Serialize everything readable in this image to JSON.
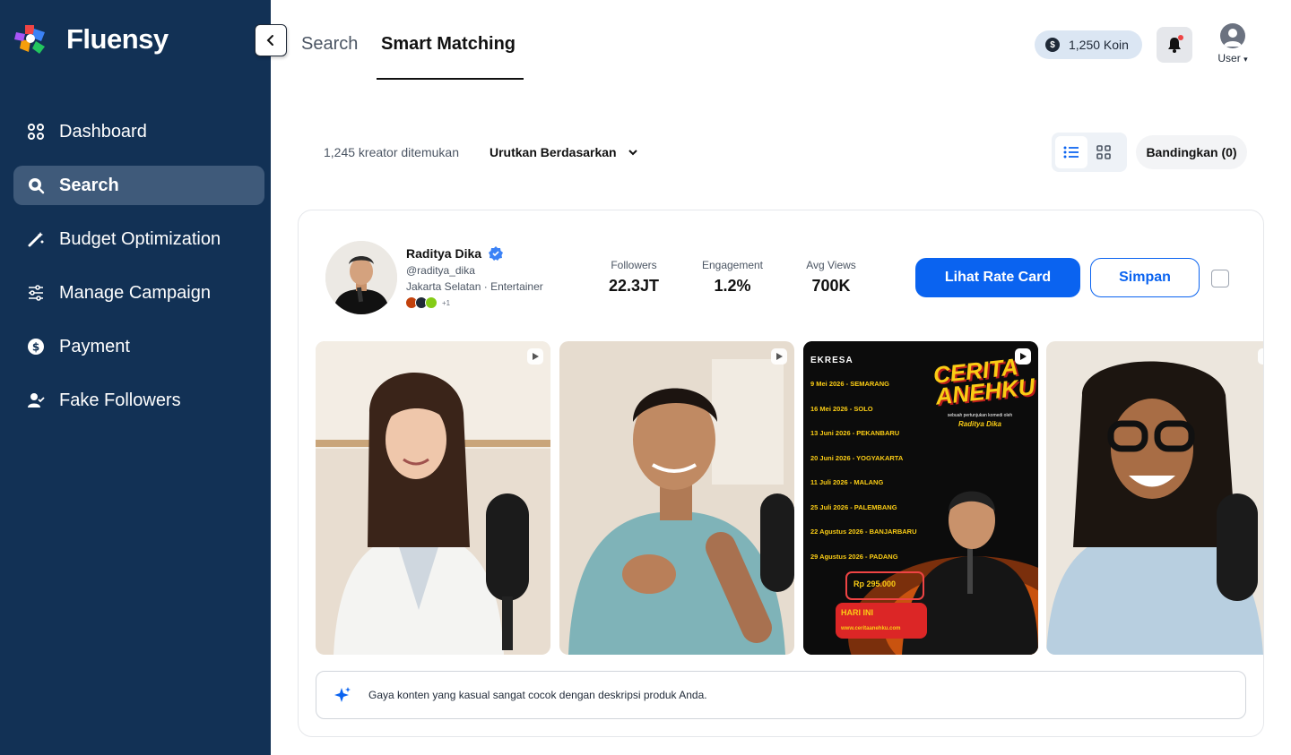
{
  "app": {
    "name": "Fluensy"
  },
  "sidebar": {
    "items": [
      {
        "label": "Dashboard",
        "icon": "dashboard-icon"
      },
      {
        "label": "Search",
        "icon": "search-icon",
        "active": true
      },
      {
        "label": "Budget Optimization",
        "icon": "magic-wand-icon"
      },
      {
        "label": "Manage Campaign",
        "icon": "sliders-icon"
      },
      {
        "label": "Payment",
        "icon": "dollar-icon"
      },
      {
        "label": "Fake Followers",
        "icon": "user-check-icon"
      }
    ]
  },
  "header": {
    "tabs": [
      {
        "label": "Search",
        "active": false
      },
      {
        "label": "Smart Matching",
        "active": true
      }
    ],
    "coin_label": "1,250 Koin",
    "user_label": "User"
  },
  "filters": {
    "count_text": "1,245 kreator ditemukan",
    "sort_label": "Urutkan Berdasarkan",
    "compare_label": "Bandingkan (0)",
    "view_mode": "list"
  },
  "creator": {
    "name": "Raditya Dika",
    "handle": "@raditya_dika",
    "location": "Jakarta Selatan",
    "category": "Entertainer",
    "extra_platforms": "+1",
    "stats": [
      {
        "label": "Followers",
        "value": "22.3JT"
      },
      {
        "label": "Engagement",
        "value": "1.2%"
      },
      {
        "label": "Avg Views",
        "value": "700K"
      }
    ],
    "rate_card_label": "Lihat Rate Card",
    "save_label": "Simpan",
    "poster": {
      "brand": "EKRESA",
      "title_line1": "CERITA",
      "title_line2": "ANEHKU",
      "byline": "sebuah pertunjukan komedi oleh",
      "byline_name": "Raditya Dika",
      "dates": [
        "9 Mei 2026 - SEMARANG",
        "16 Mei 2026 - SOLO",
        "13 Juni 2026 - PEKANBARU",
        "20 Juni 2026 - YOGYAKARTA",
        "11 Juli 2026 - MALANG",
        "25 Juli 2026 - PALEMBANG",
        "22 Agustus 2026 - BANJARBARU",
        "29 Agustus 2026 - PADANG"
      ],
      "price": "Rp 295.000",
      "sale_label": "HARI INI",
      "website": "www.ceritaanehku.com"
    },
    "ai_note": "Gaya konten yang kasual sangat cocok dengan deskripsi produk Anda."
  },
  "colors": {
    "sidebar_bg": "#123155",
    "sidebar_active": "#3f5a7a",
    "primary": "#0a63f0",
    "coin_bg": "#dbe6f3"
  }
}
